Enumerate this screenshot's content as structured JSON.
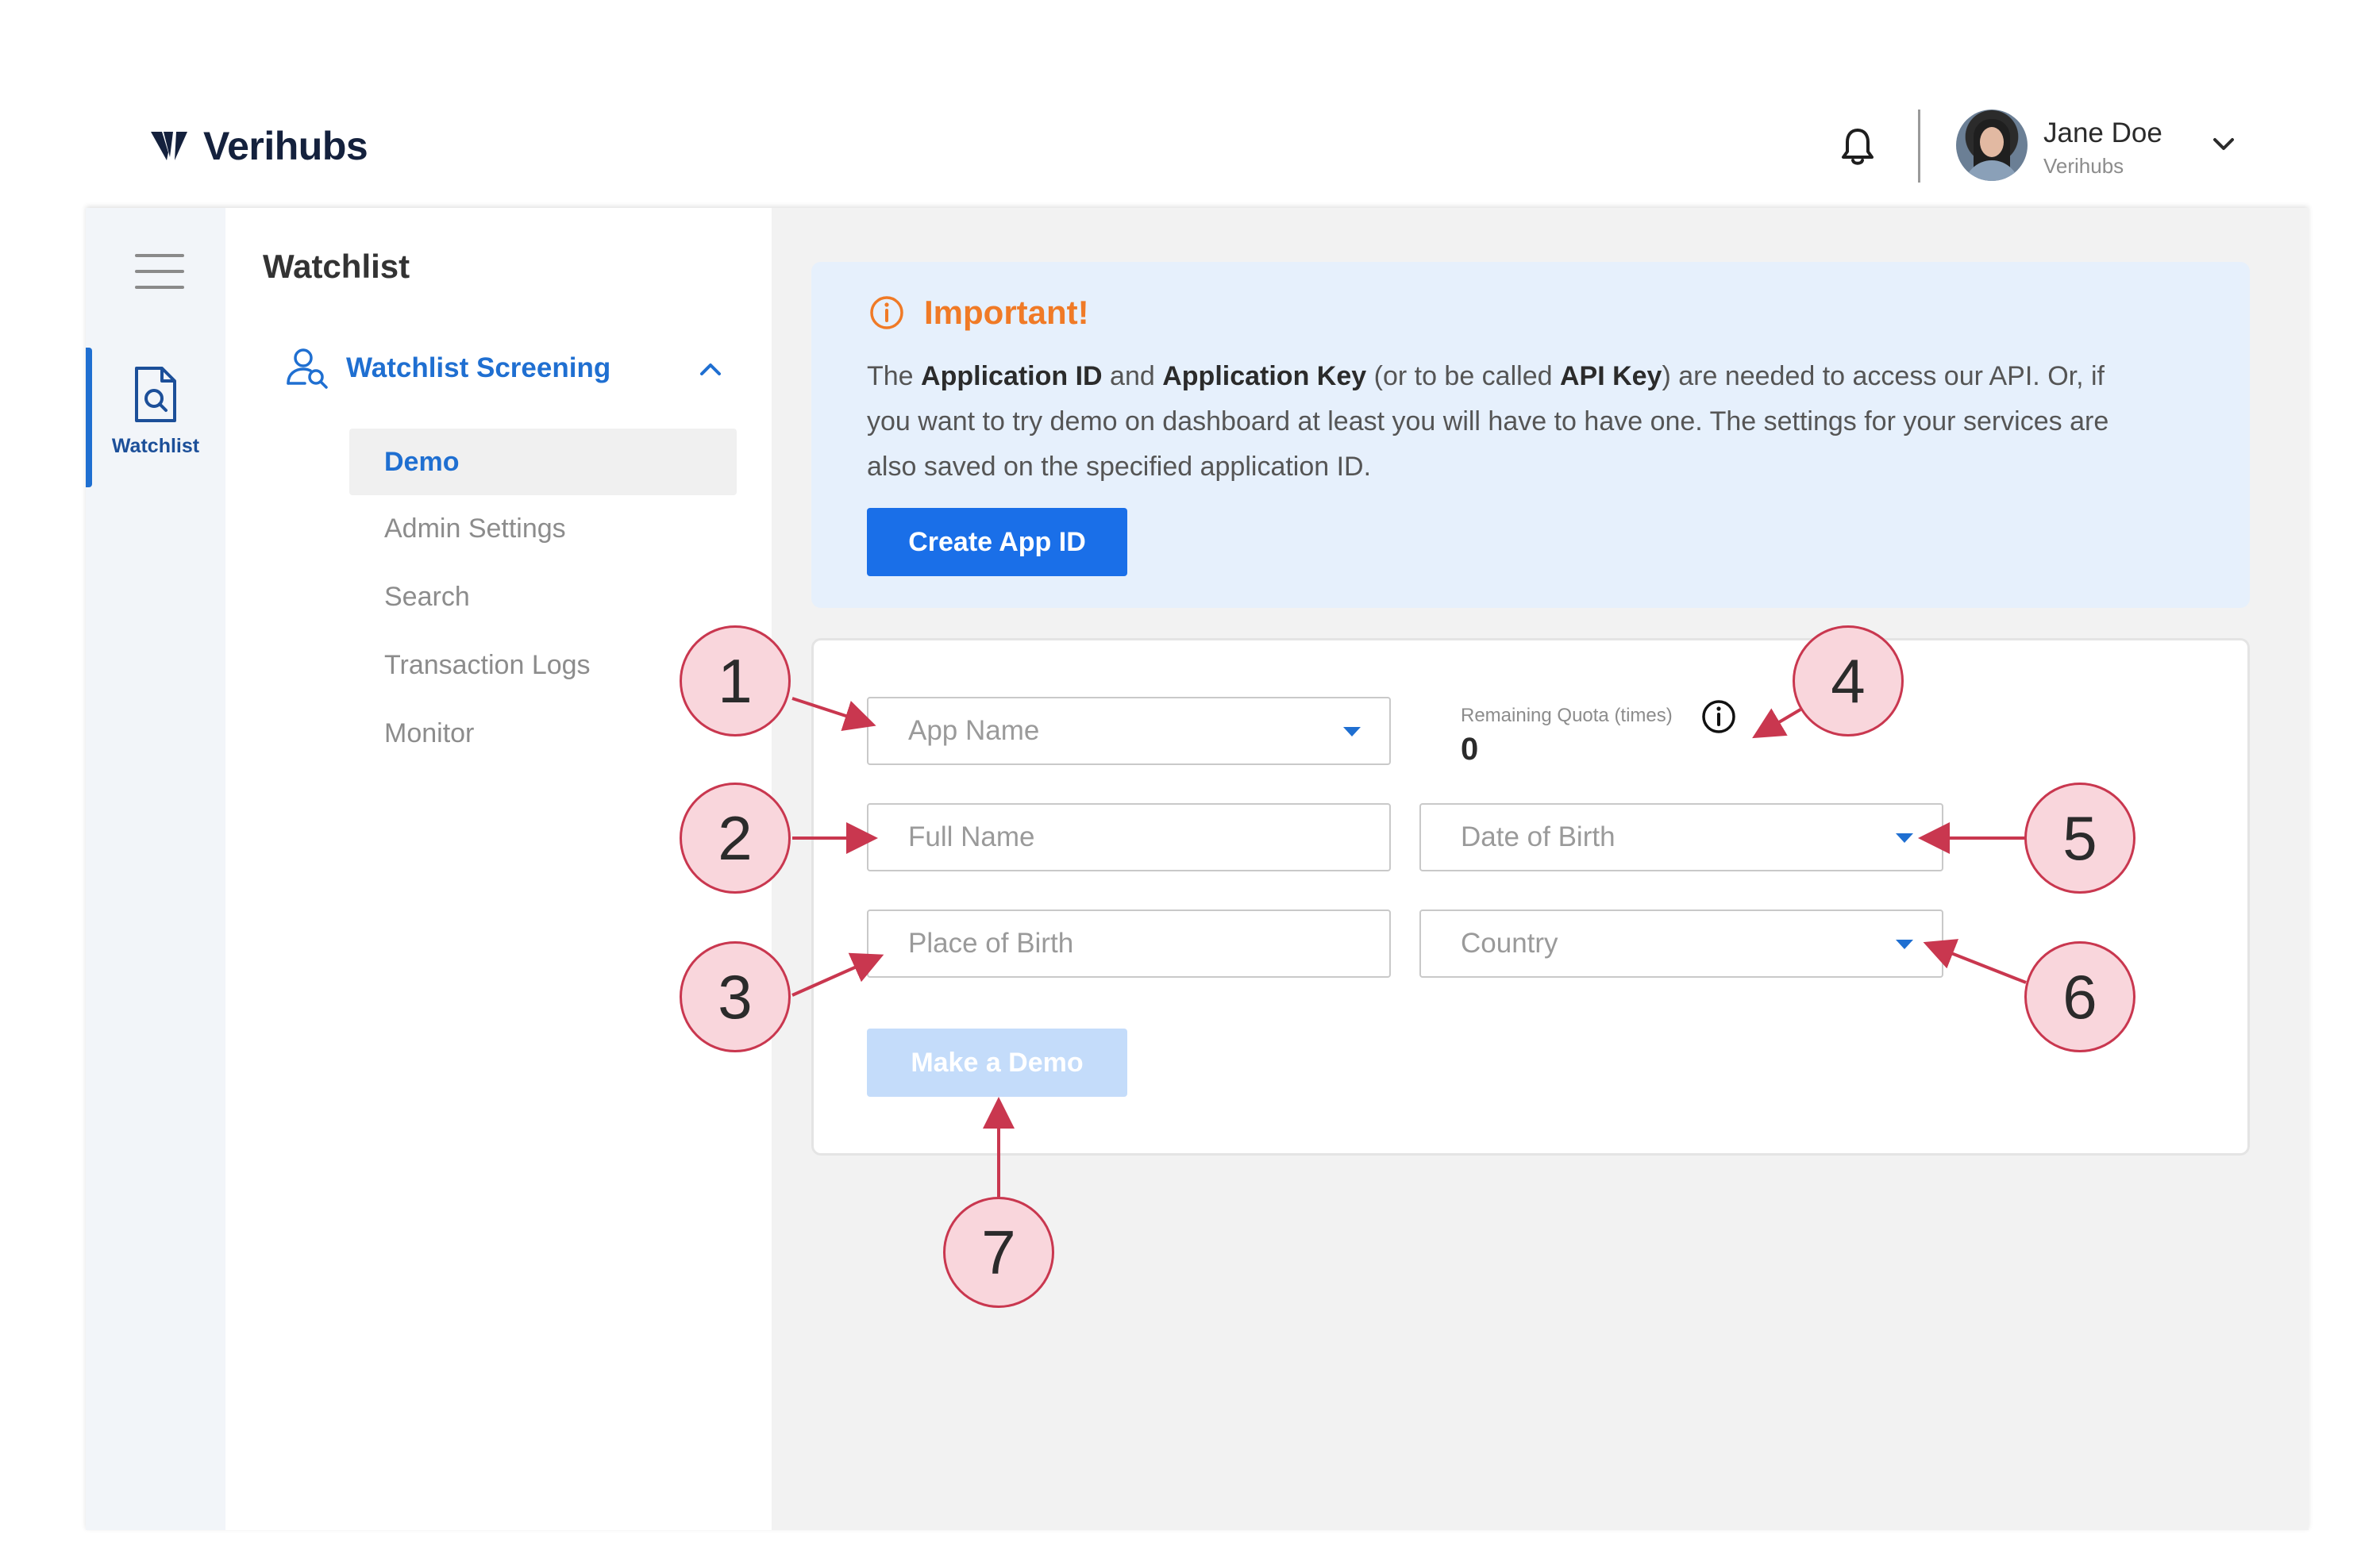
{
  "header": {
    "brand": "Verihubs",
    "user_name": "Jane Doe",
    "user_org": "Verihubs"
  },
  "rail": {
    "item_label": "Watchlist"
  },
  "subnav": {
    "title": "Watchlist",
    "group_label": "Watchlist Screening",
    "items": [
      {
        "label": "Demo",
        "active": true
      },
      {
        "label": "Admin Settings",
        "active": false
      },
      {
        "label": "Search",
        "active": false
      },
      {
        "label": "Transaction Logs",
        "active": false
      },
      {
        "label": "Monitor",
        "active": false
      }
    ]
  },
  "notice": {
    "title": "Important!",
    "text_parts": [
      "The ",
      "Application ID",
      " and ",
      "Application Key",
      " (or to be called ",
      "API Key",
      ") are needed to access our API. Or, if you want to try demo on dashboard at least you will have to have one. The settings for your services are also saved on the specified application ID."
    ],
    "create_button": "Create App ID"
  },
  "form": {
    "app_name_placeholder": "App Name",
    "full_name_placeholder": "Full Name",
    "place_of_birth_placeholder": "Place of Birth",
    "date_of_birth_placeholder": "Date of Birth",
    "country_placeholder": "Country",
    "quota_label": "Remaining Quota (times)",
    "quota_value": "0",
    "demo_button": "Make a Demo"
  },
  "callouts": [
    "1",
    "2",
    "3",
    "4",
    "5",
    "6",
    "7"
  ],
  "colors": {
    "accent": "#1a6fe8",
    "warning": "#f07a26",
    "callout_fill": "#f9d6dc",
    "callout_stroke": "#c9374f"
  }
}
